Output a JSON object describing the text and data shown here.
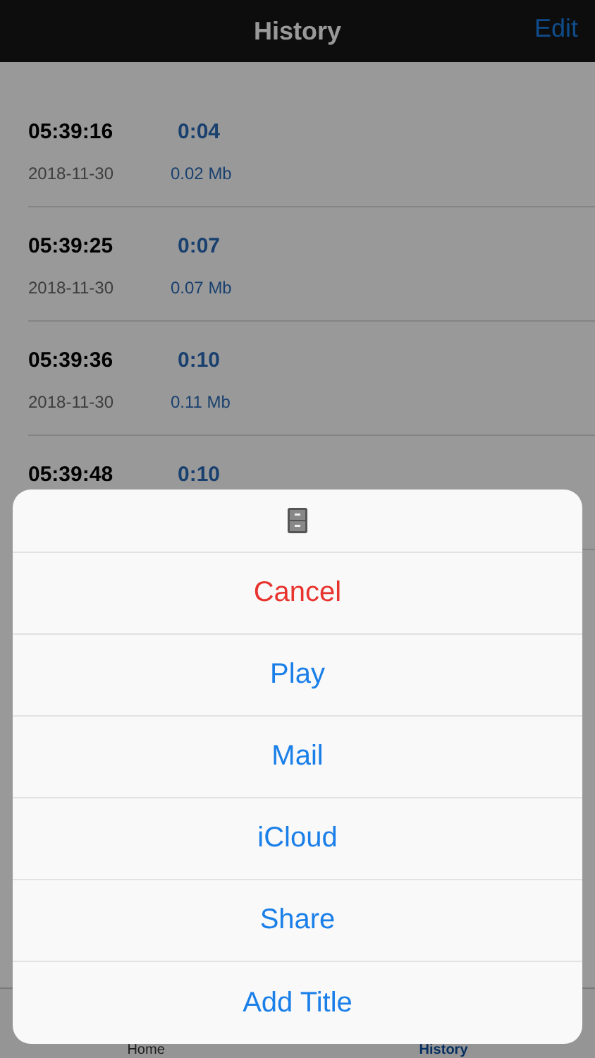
{
  "nav_bar": {
    "title": "History",
    "edit_button": "Edit"
  },
  "recordings": [
    {
      "time": "05:39:16",
      "duration": "0:04",
      "date": "2018-11-30",
      "size": "0.02 Mb"
    },
    {
      "time": "05:39:25",
      "duration": "0:07",
      "date": "2018-11-30",
      "size": "0.07 Mb"
    },
    {
      "time": "05:39:36",
      "duration": "0:10",
      "date": "2018-11-30",
      "size": "0.11 Mb"
    },
    {
      "time": "05:39:48",
      "duration": "0:10"
    }
  ],
  "tab_bar": [
    {
      "label": "Home",
      "selected": false
    },
    {
      "label": "History",
      "selected": true
    }
  ],
  "action_sheet": {
    "actions": [
      {
        "label": "Cancel",
        "kind": "destructive"
      },
      {
        "label": "Play",
        "kind": "default"
      },
      {
        "label": "Mail",
        "kind": "default"
      },
      {
        "label": "iCloud",
        "kind": "default"
      },
      {
        "label": "Share",
        "kind": "default"
      },
      {
        "label": "Add Title",
        "kind": "default"
      }
    ]
  }
}
